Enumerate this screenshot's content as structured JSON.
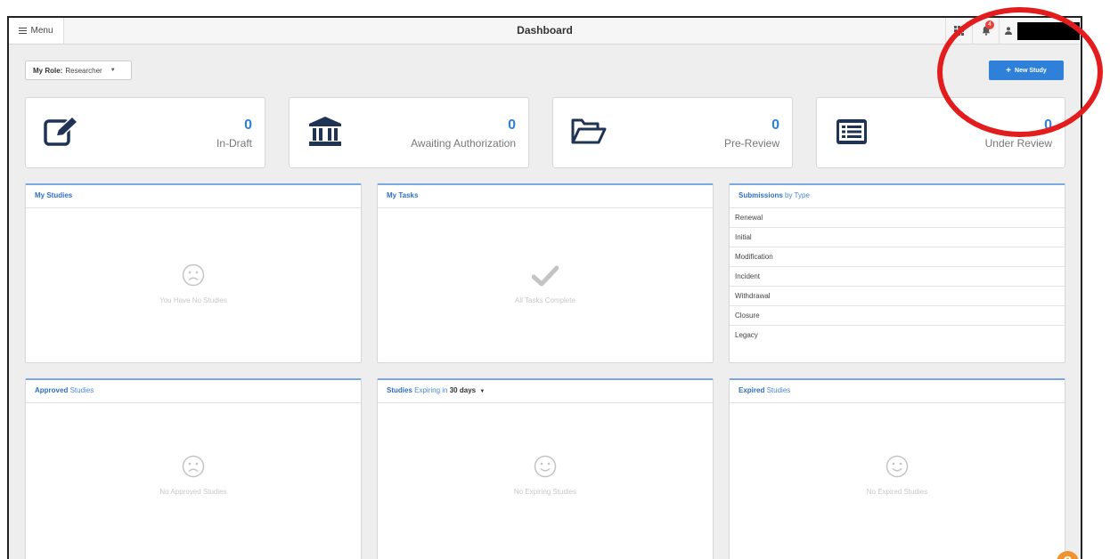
{
  "topbar": {
    "menu_label": "Menu",
    "title": "Dashboard",
    "notification_count": "4"
  },
  "role": {
    "label": "My Role:",
    "value": "Researcher"
  },
  "new_study_button": "New Study",
  "stats": [
    {
      "count": "0",
      "label": "In-Draft",
      "icon": "pencil-edit-icon"
    },
    {
      "count": "0",
      "label": "Awaiting Authorization",
      "icon": "bank-icon"
    },
    {
      "count": "0",
      "label": "Pre-Review",
      "icon": "folder-open-icon"
    },
    {
      "count": "0",
      "label": "Under Review",
      "icon": "list-card-icon"
    }
  ],
  "panels": {
    "my_studies": {
      "title": "My Studies",
      "empty": "You Have No Studies"
    },
    "my_tasks": {
      "title": "My Tasks",
      "empty": "All Tasks Complete"
    },
    "submissions": {
      "title_bold": "Submissions",
      "title_rest": "by Type",
      "items": [
        "Renewal",
        "Initial",
        "Modification",
        "Incident",
        "Withdrawal",
        "Closure",
        "Legacy"
      ]
    },
    "approved": {
      "title_bold": "Approved",
      "title_rest": "Studies",
      "empty": "No Approved Studies"
    },
    "expiring": {
      "title_bold": "Studies",
      "title_rest": "Expiring in",
      "period": "30 days",
      "empty": "No Expiring Studies"
    },
    "expired": {
      "title_bold": "Expired",
      "title_rest": "Studies",
      "empty": "No Expired Studies"
    }
  },
  "help_label": "?",
  "colors": {
    "accent": "#2f80d8",
    "annotation": "#e31d1d",
    "help": "#f0922e"
  }
}
